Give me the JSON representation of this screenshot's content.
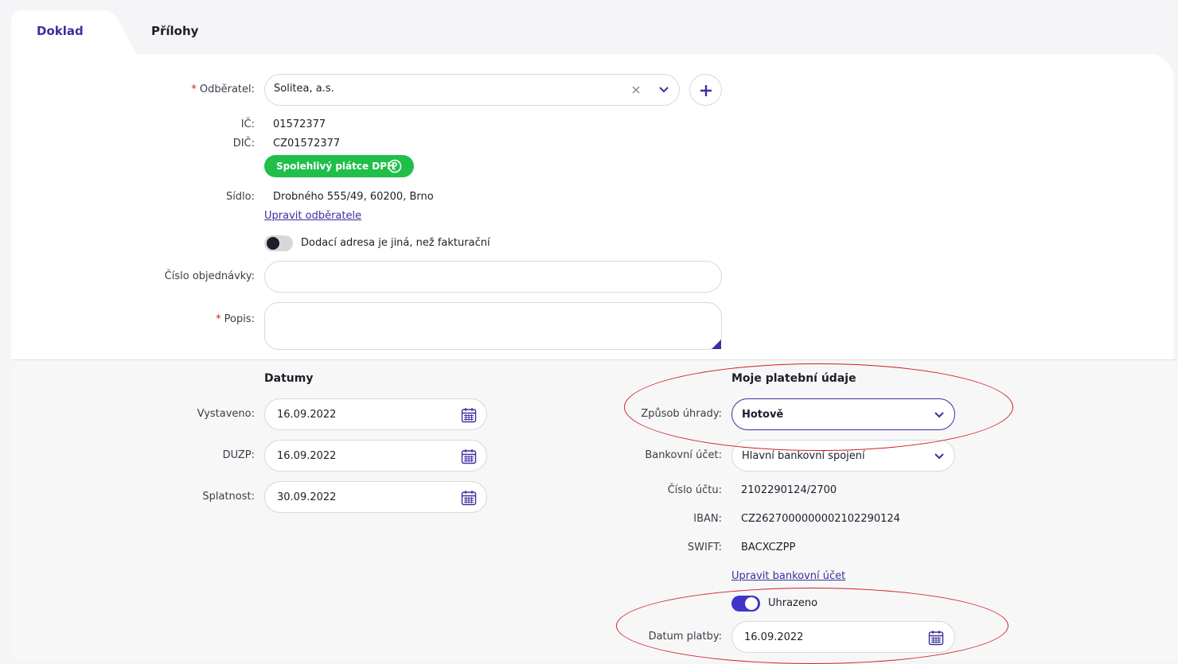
{
  "tabs": [
    {
      "label": "Doklad",
      "active": true
    },
    {
      "label": "Přílohy",
      "active": false
    }
  ],
  "customer": {
    "label": "Odběratel:",
    "value": "Solitea, a.s.",
    "ic_label": "IČ:",
    "ic_value": "01572377",
    "dic_label": "DIČ:",
    "dic_value": "CZ01572377",
    "badge": "Spolehlivý plátce DPH",
    "seat_label": "Sídlo:",
    "seat_value": "Drobného 555/49, 60200, Brno",
    "edit_link": "Upravit odběratele",
    "delivery_toggle_label": "Dodací adresa je jiná, než fakturační",
    "delivery_toggle_on": false
  },
  "order": {
    "label": "Číslo objednávky:",
    "value": ""
  },
  "description": {
    "label": "Popis:",
    "value": ""
  },
  "dates": {
    "title": "Datumy",
    "issued_label": "Vystaveno:",
    "issued_value": "16.09.2022",
    "duzp_label": "DUZP:",
    "duzp_value": "16.09.2022",
    "due_label": "Splatnost:",
    "due_value": "30.09.2022"
  },
  "payment": {
    "title": "Moje platební údaje",
    "method_label": "Způsob úhrady:",
    "method_value": "Hotově",
    "bank_label": "Bankovní účet:",
    "bank_value": "Hlavní bankovní spojení",
    "account_label": "Číslo účtu:",
    "account_value": "2102290124/2700",
    "iban_label": "IBAN:",
    "iban_value": "CZ2627000000002102290124",
    "swift_label": "SWIFT:",
    "swift_value": "BACXCZPP",
    "edit_link": "Upravit bankovní účet",
    "paid_label": "Uhrazeno",
    "paid_on": true,
    "paid_date_label": "Datum platby:",
    "paid_date_value": "16.09.2022"
  },
  "colors": {
    "accent": "#3b2f9e",
    "toggle_on": "#3f35c9",
    "badge_green": "#1fbf4a",
    "required": "#d0201c",
    "annotation_red": "#d21f26"
  },
  "icons": [
    "close-icon",
    "chevron-down-icon",
    "plus-icon",
    "question-icon",
    "calendar-icon"
  ]
}
